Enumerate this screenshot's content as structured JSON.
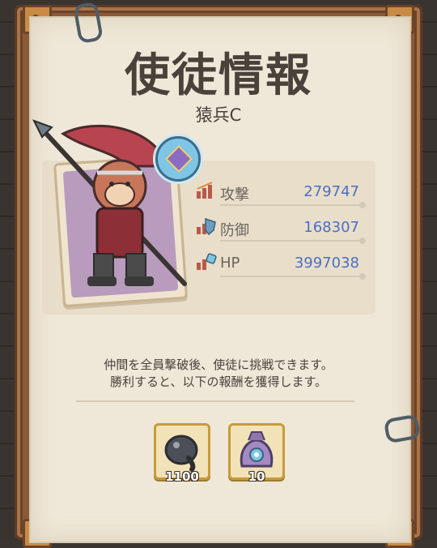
{
  "header": {
    "title": "使徒情報",
    "subtitle": "猿兵C"
  },
  "stats": [
    {
      "label": "攻撃",
      "value": "279747",
      "icon": "attack-icon"
    },
    {
      "label": "防御",
      "value": "168307",
      "icon": "defense-icon"
    },
    {
      "label": "HP",
      "value": "3997038",
      "icon": "hp-icon"
    }
  ],
  "description": {
    "line1": "仲間を全員撃破後、使徒に挑戦できます。",
    "line2": "勝利すると、以下の報酬を獲得します。"
  },
  "rewards": [
    {
      "icon": "dark-orb-icon",
      "count": "1100"
    },
    {
      "icon": "treasure-sack-icon",
      "count": "10"
    }
  ],
  "colors": {
    "value_blue": "#4c6fc2",
    "title_ink": "#4a413b",
    "paper": "#efe8d8",
    "frame_wood": "#8a5a38"
  }
}
